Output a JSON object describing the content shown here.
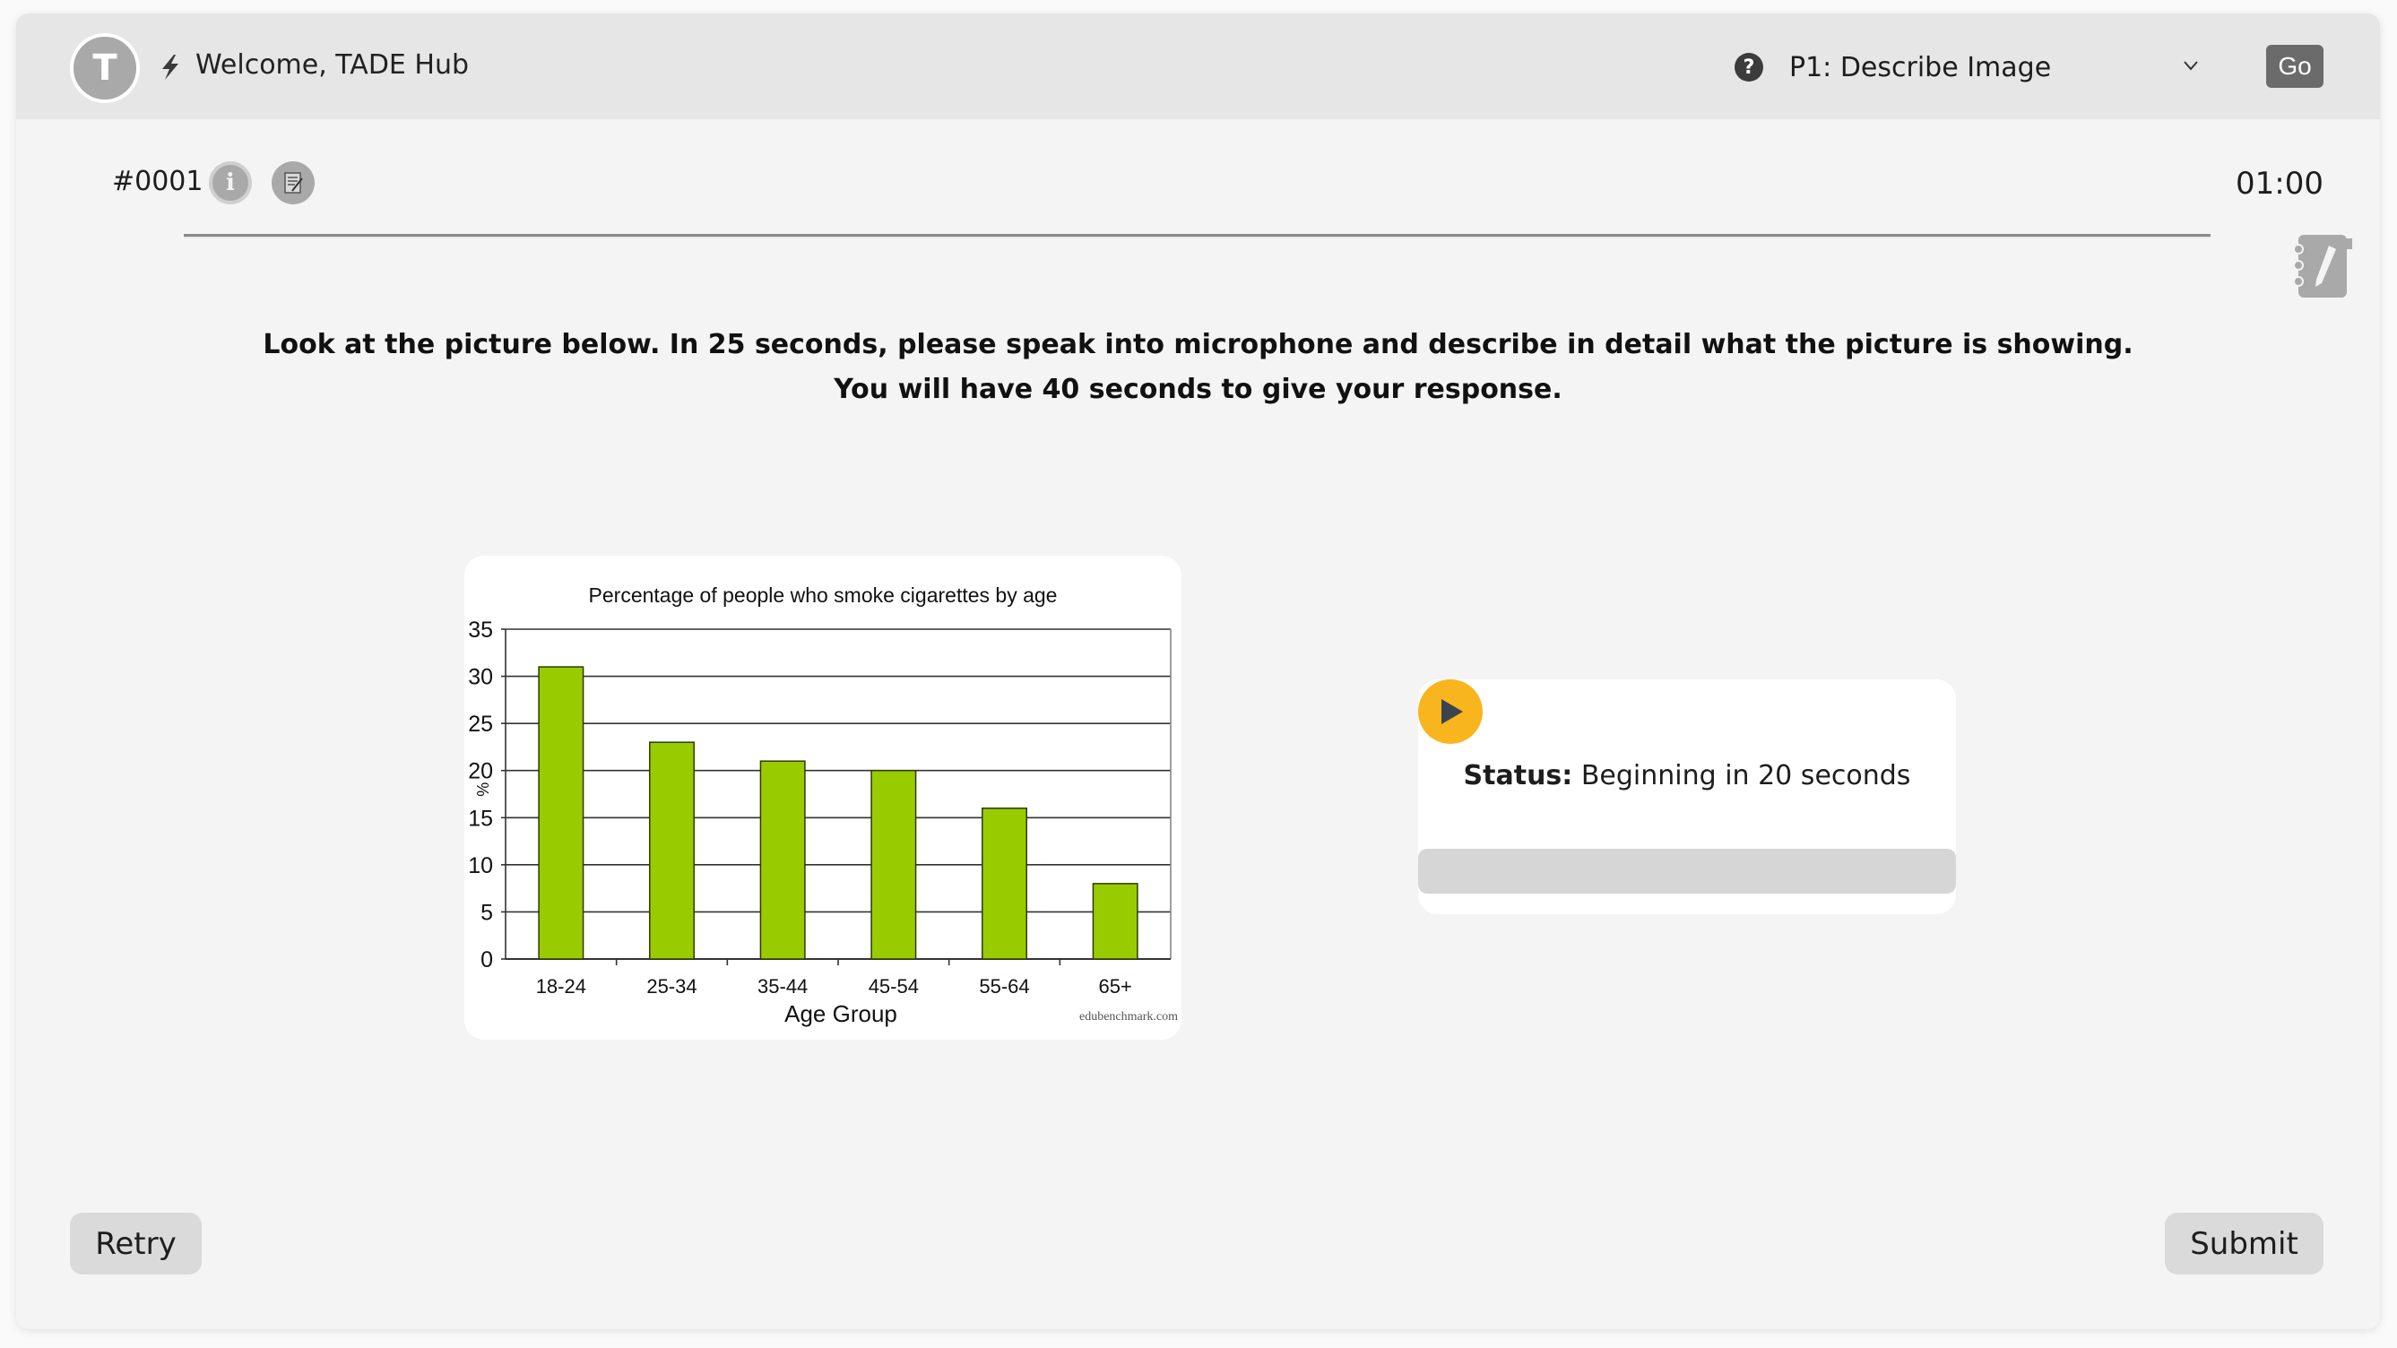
{
  "header": {
    "avatar_initial": "T",
    "welcome_text": "Welcome, TADE Hub",
    "help_icon": "question-circle-icon",
    "task_select_value": "P1: Describe Image",
    "go_label": "Go"
  },
  "question": {
    "number": "#0001",
    "timer": "01:00",
    "instructions_line1": "Look at the picture below. In 25 seconds, please speak into microphone and describe in detail what the picture is showing.",
    "instructions_line2": "You will have 40 seconds to give your response."
  },
  "recorder": {
    "status_label": "Status:",
    "status_value": "Beginning in 20 seconds",
    "progress_percent": 0,
    "accent_color": "#f9b51e"
  },
  "footer": {
    "retry_label": "Retry",
    "submit_label": "Submit"
  },
  "chart_data": {
    "type": "bar",
    "title": "Percentage of people who smoke cigarettes by age",
    "xlabel": "Age Group",
    "ylabel": "%",
    "categories": [
      "18-24",
      "25-34",
      "35-44",
      "45-54",
      "55-64",
      "65+"
    ],
    "values": [
      31,
      23,
      21,
      20,
      16,
      8
    ],
    "ylim": [
      0,
      35
    ],
    "yticks": [
      0,
      5,
      10,
      15,
      20,
      25,
      30,
      35
    ],
    "grid": true,
    "bar_color": "#99cc00",
    "watermark": "edubenchmark.com"
  }
}
